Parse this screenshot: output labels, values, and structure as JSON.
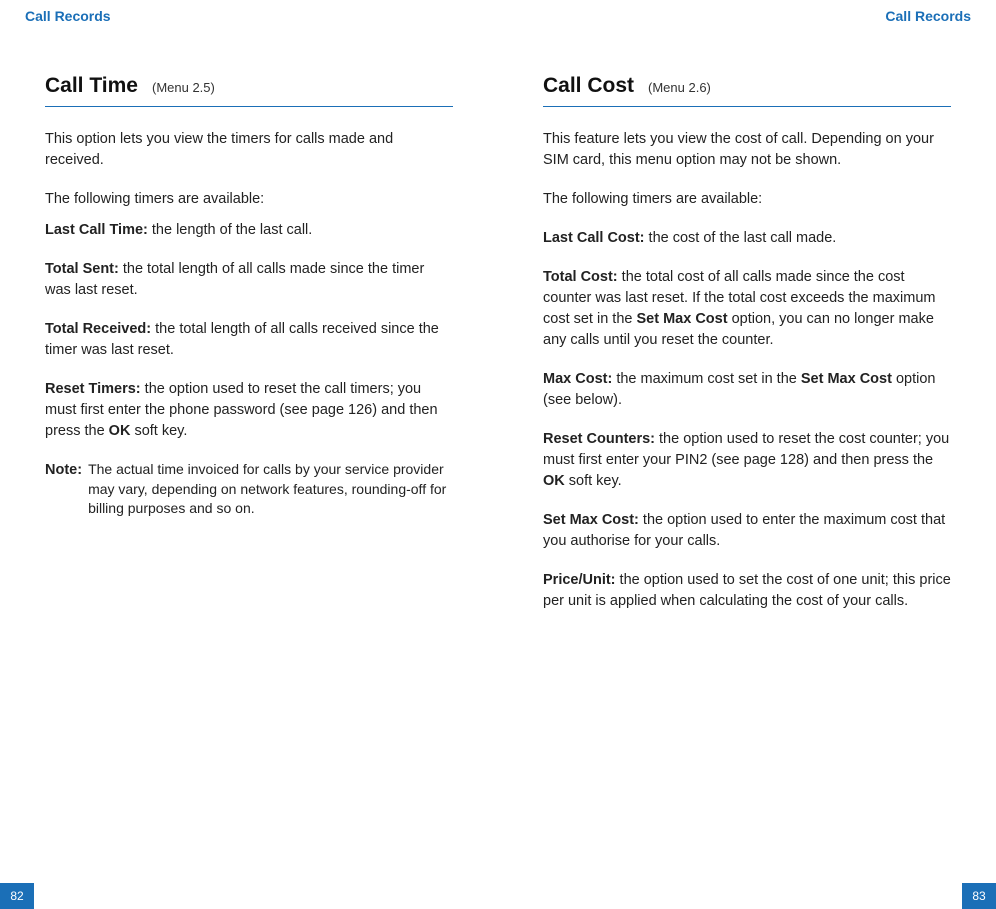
{
  "header": {
    "left": "Call Records",
    "right": "Call Records"
  },
  "left": {
    "title": "Call Time",
    "menu": "(Menu 2.5)",
    "intro": "This option lets you view the timers for calls made and received.",
    "timers_lead": "The following timers are available:",
    "items": {
      "last_call_time_label": "Last Call Time:",
      "last_call_time_text": " the length of the last call.",
      "total_sent_label": "Total Sent:",
      "total_sent_text": " the total length of all calls made since the timer was last reset.",
      "total_received_label": "Total Received:",
      "total_received_text": " the total length of all calls received since the timer was last reset.",
      "reset_timers_label": "Reset Timers:",
      "reset_timers_text_a": " the option used to reset the call timers; you must first enter the phone password (see page 126) and then press the ",
      "reset_timers_ok": "OK",
      "reset_timers_text_b": " soft key."
    },
    "note_label": "Note:",
    "note_text": "The actual time invoiced for calls by your service provider may vary, depending on network features, rounding-off for billing purposes and so on.",
    "page_number": "82"
  },
  "right": {
    "title": "Call Cost",
    "menu": "(Menu 2.6)",
    "intro": "This feature lets you view the cost of call. Depending on your SIM card, this menu option may not be shown.",
    "timers_lead": "The following timers are available:",
    "items": {
      "last_call_cost_label": "Last Call Cost:",
      "last_call_cost_text": " the cost of the last call made.",
      "total_cost_label": "Total Cost:",
      "total_cost_text_a": " the total cost of all calls made since the cost counter was last reset. If the total cost exceeds the maximum cost set in the ",
      "total_cost_set_max": "Set Max Cost",
      "total_cost_text_b": " option, you can no longer make any calls until you reset the counter.",
      "max_cost_label": "Max Cost:",
      "max_cost_text_a": " the maximum cost set in the ",
      "max_cost_set_max": "Set Max Cost",
      "max_cost_text_b": " option (see below).",
      "reset_counters_label": "Reset Counters:",
      "reset_counters_text_a": " the option used to reset the cost counter; you must first enter your PIN2 (see page 128) and then press the ",
      "reset_counters_ok": "OK",
      "reset_counters_text_b": " soft key.",
      "set_max_cost_label": "Set Max Cost:",
      "set_max_cost_text": " the option used to enter the maximum cost that you authorise for your calls.",
      "price_unit_label": "Price/Unit:",
      "price_unit_text": " the option used to set the cost of one unit; this price per unit is applied when calculating the cost of your calls."
    },
    "page_number": "83"
  }
}
